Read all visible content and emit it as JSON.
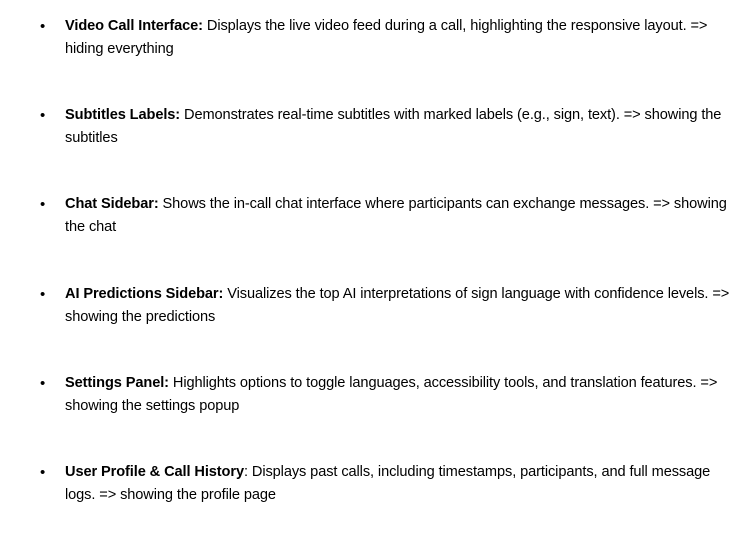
{
  "bullet_glyph": "•",
  "items": [
    {
      "title": "Video Call Interface:",
      "body": " Displays the live video feed during a call, highlighting the responsive layout. => hiding everything"
    },
    {
      "title": "Subtitles Labels:",
      "body": " Demonstrates real-time subtitles with marked labels (e.g., sign, text). => showing the subtitles"
    },
    {
      "title": "Chat Sidebar:",
      "body": " Shows the in-call chat interface where participants can exchange messages. => showing the chat"
    },
    {
      "title": "AI Predictions Sidebar:",
      "body": " Visualizes the top AI interpretations of sign language with confidence levels.  => showing the predictions"
    },
    {
      "title": "Settings Panel:",
      "body": " Highlights options to toggle languages, accessibility tools, and translation features.  => showing the settings popup"
    },
    {
      "title": "User Profile & Call History",
      "body": ": Displays past calls, including timestamps, participants, and full message logs.  => showing the profile page"
    }
  ]
}
